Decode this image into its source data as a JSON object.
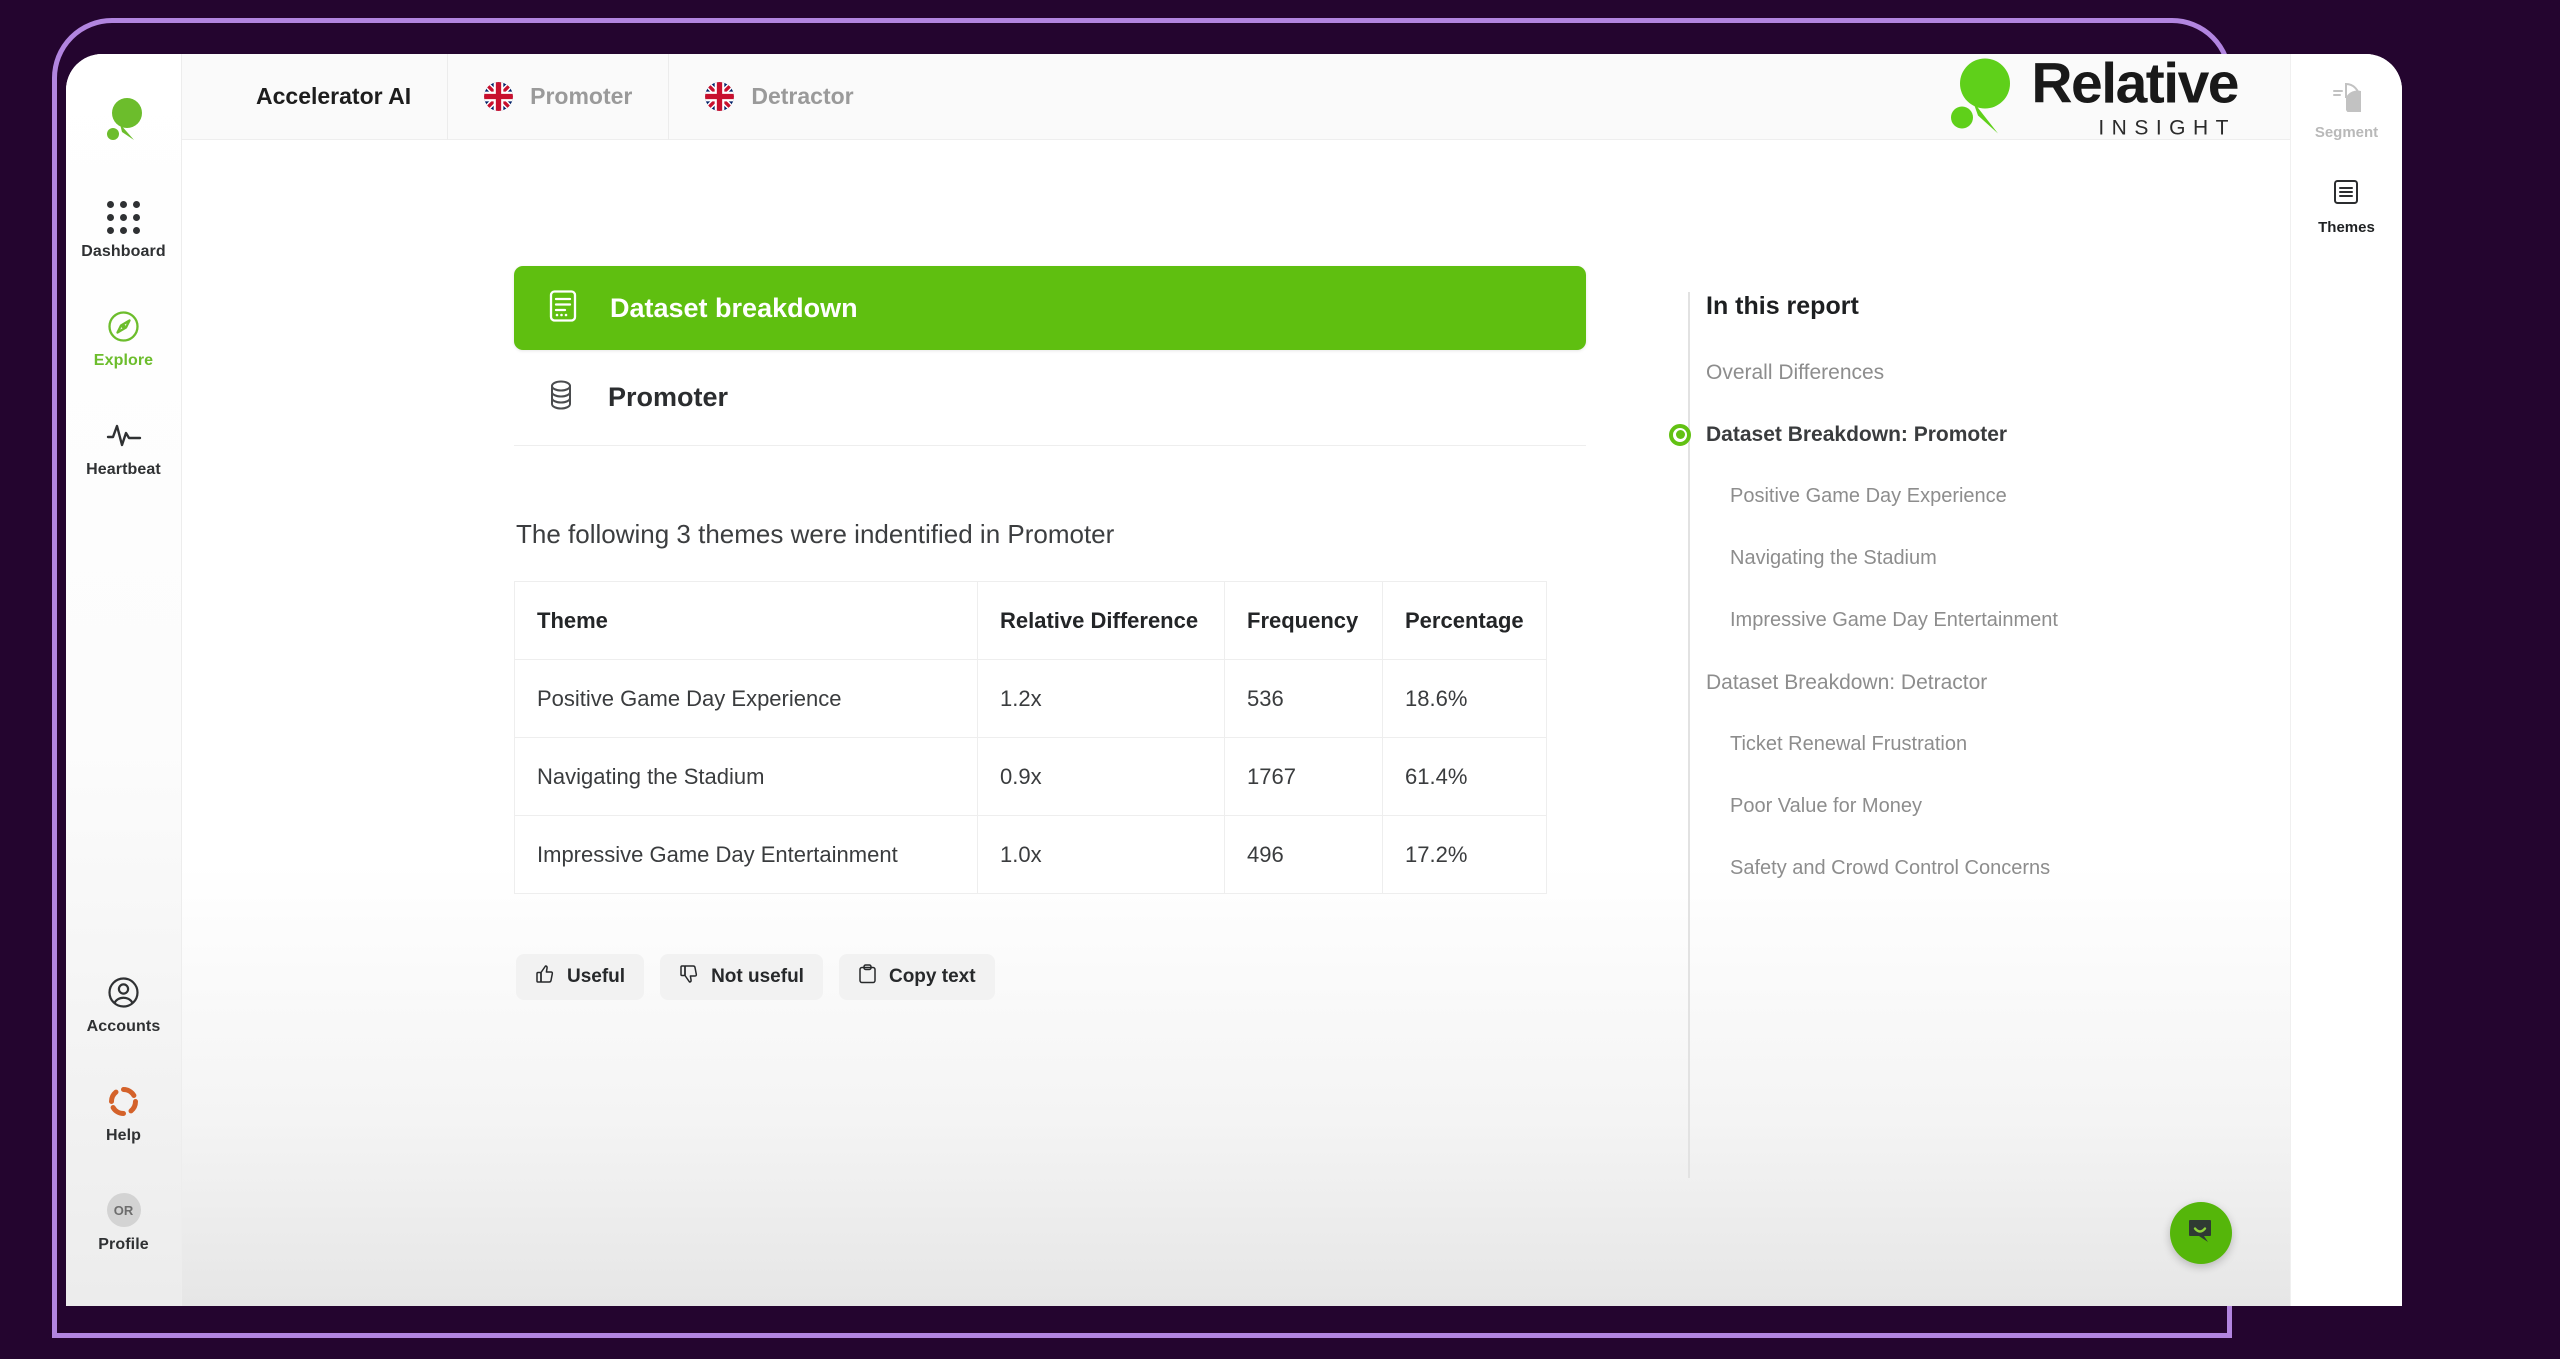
{
  "brand": {
    "name_primary": "Relative",
    "name_secondary": "INSIGHT"
  },
  "topbar": {
    "tabs": [
      {
        "label": "Accelerator AI",
        "icon": "",
        "active": true
      },
      {
        "label": "Promoter",
        "icon": "uk-flag-icon",
        "active": false
      },
      {
        "label": "Detractor",
        "icon": "uk-flag-icon",
        "active": false
      }
    ]
  },
  "sidebar": {
    "top_items": [
      {
        "label": "Dashboard",
        "icon": "grid-dots-icon",
        "active": false
      },
      {
        "label": "Explore",
        "icon": "compass-icon",
        "active": true
      },
      {
        "label": "Heartbeat",
        "icon": "pulse-icon",
        "active": false
      }
    ],
    "bottom_items": [
      {
        "label": "Accounts",
        "icon": "user-circle-icon",
        "active": false
      },
      {
        "label": "Help",
        "icon": "lifebuoy-icon",
        "active": false
      },
      {
        "label": "Profile",
        "icon": "avatar-icon",
        "avatar_initials": "OR",
        "active": false
      }
    ]
  },
  "report": {
    "section_banner": {
      "title": "Dataset breakdown",
      "icon": "report-document-icon"
    },
    "section_sub": {
      "title": "Promoter",
      "icon": "database-icon"
    },
    "paragraph": "The following 3 themes were indentified in Promoter",
    "table": {
      "columns": [
        "Theme",
        "Relative Difference",
        "Frequency",
        "Percentage"
      ],
      "rows": [
        [
          "Positive Game Day Experience",
          "1.2x",
          "536",
          "18.6%"
        ],
        [
          "Navigating the Stadium",
          "0.9x",
          "1767",
          "61.4%"
        ],
        [
          "Impressive Game Day Entertainment",
          "1.0x",
          "496",
          "17.2%"
        ]
      ]
    },
    "feedback": [
      {
        "label": "Useful",
        "icon": "thumbs-up-icon"
      },
      {
        "label": "Not useful",
        "icon": "thumbs-down-icon"
      },
      {
        "label": "Copy text",
        "icon": "clipboard-icon"
      }
    ]
  },
  "toc": {
    "heading": "In this report",
    "items": [
      {
        "label": "Overall Differences",
        "level": 1,
        "current": false
      },
      {
        "label": "Dataset Breakdown: Promoter",
        "level": 1,
        "current": true
      },
      {
        "label": "Positive Game Day Experience",
        "level": 2,
        "current": false
      },
      {
        "label": "Navigating the Stadium",
        "level": 2,
        "current": false
      },
      {
        "label": "Impressive Game Day Entertainment",
        "level": 2,
        "current": false
      },
      {
        "label": "Dataset Breakdown: Detractor",
        "level": 1,
        "current": false
      },
      {
        "label": "Ticket Renewal Frustration",
        "level": 2,
        "current": false
      },
      {
        "label": "Poor Value for Money",
        "level": 2,
        "current": false
      },
      {
        "label": "Safety and Crowd Control Concerns",
        "level": 2,
        "current": false
      }
    ]
  },
  "right_rail": {
    "items": [
      {
        "label": "Segment",
        "icon": "pie-chart-icon",
        "muted": true
      },
      {
        "label": "Themes",
        "icon": "themes-list-icon",
        "muted": false
      }
    ]
  },
  "chat": {
    "icon": "chat-bubble-icon"
  },
  "colors": {
    "accent_green": "#5fbf10",
    "frame_purple": "#24052f",
    "frame_ring": "#b285e0",
    "help_orange": "#d4622a"
  }
}
